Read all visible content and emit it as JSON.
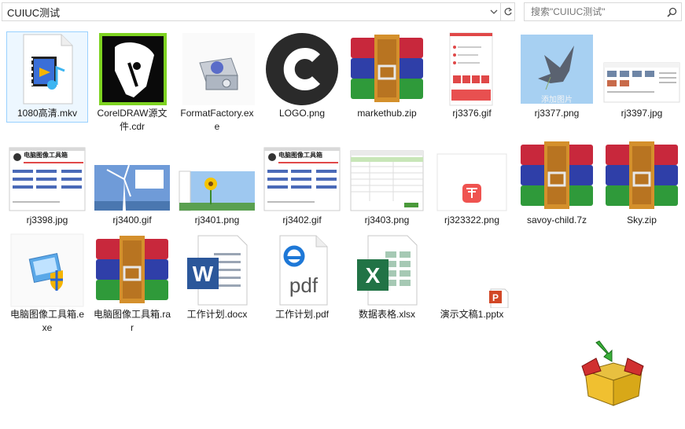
{
  "address": {
    "path": "CUIUC测试"
  },
  "search": {
    "placeholder": "搜索\"CUIUC测试\""
  },
  "files": [
    {
      "name": "1080高清.mkv",
      "icon": "mkv-video-file-icon"
    },
    {
      "name": "CorelDRAW源文件.cdr",
      "icon": "coreldraw-file-icon"
    },
    {
      "name": "FormatFactory.exe",
      "icon": "formatfactory-app-icon"
    },
    {
      "name": "LOGO.png",
      "icon": "logo-c-icon"
    },
    {
      "name": "markethub.zip",
      "icon": "winrar-archive-icon"
    },
    {
      "name": "rj3376.gif",
      "icon": "mobile-screenshot-thumbnail"
    },
    {
      "name": "rj3377.png",
      "icon": "pigeon-photo-thumbnail"
    },
    {
      "name": "rj3397.jpg",
      "icon": "webpage-screenshot-thumbnail"
    },
    {
      "name": "rj3398.jpg",
      "icon": "software-screenshot-thumbnail"
    },
    {
      "name": "rj3400.gif",
      "icon": "wind-turbine-thumbnail"
    },
    {
      "name": "rj3401.png",
      "icon": "sunflower-desktop-thumbnail"
    },
    {
      "name": "rj3402.gif",
      "icon": "software-screenshot-thumbnail"
    },
    {
      "name": "rj3403.png",
      "icon": "spreadsheet-screenshot-thumbnail"
    },
    {
      "name": "rj323322.png",
      "icon": "red-app-icon-thumbnail"
    },
    {
      "name": "savoy-child.7z",
      "icon": "winrar-archive-icon"
    },
    {
      "name": "Sky.zip",
      "icon": "winrar-archive-icon"
    },
    {
      "name": "电脑图像工具箱.exe",
      "icon": "installer-exe-icon"
    },
    {
      "name": "电脑图像工具箱.rar",
      "icon": "winrar-archive-icon"
    },
    {
      "name": "工作计划.docx",
      "icon": "word-document-icon"
    },
    {
      "name": "工作计划.pdf",
      "icon": "pdf-document-icon"
    },
    {
      "name": "数据表格.xlsx",
      "icon": "excel-document-icon"
    },
    {
      "name": "演示文稿1.pptx",
      "icon": "powerpoint-document-icon"
    }
  ],
  "thumb_text": {
    "app_title": "电脑图像工具箱",
    "pigeon_caption": "添加图片"
  },
  "icon_letters": {
    "word": "W",
    "excel": "X",
    "pdf": "pdf",
    "ppt": "P"
  },
  "colors": {
    "selection_border": "#99d1ff",
    "selection_fill": "#cce8ff",
    "rar_red": "#c8283c",
    "rar_blue": "#2f3fa8",
    "rar_green": "#2f9a3a",
    "rar_strap": "#d4902c",
    "word_blue": "#2b579a",
    "excel_green": "#217346",
    "ppt_red": "#d24726",
    "pdf_blue": "#1e78d7"
  }
}
